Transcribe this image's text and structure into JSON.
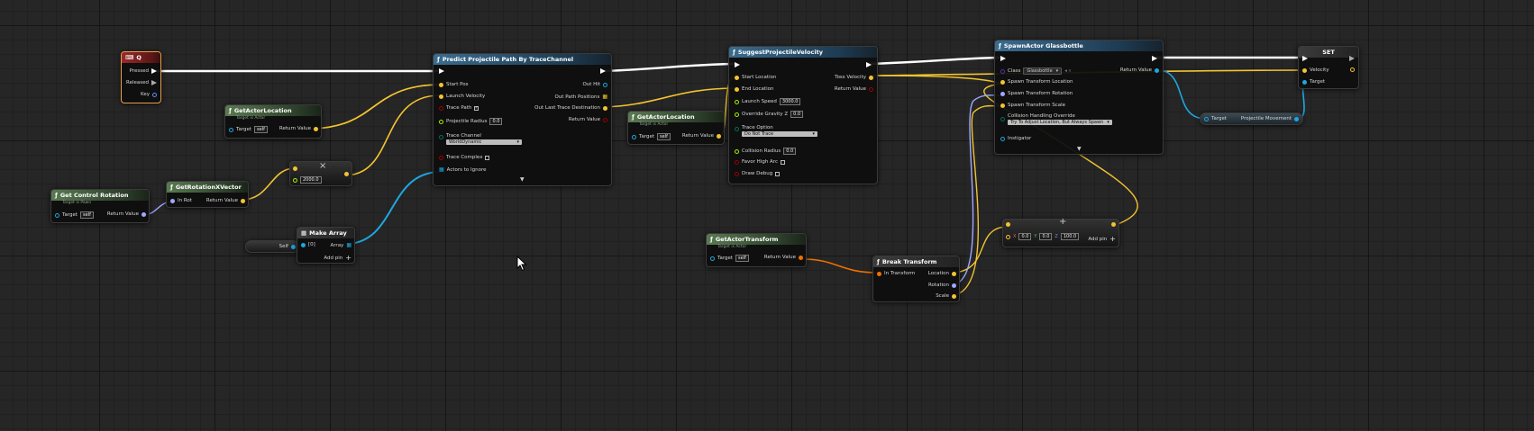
{
  "colors": {
    "exec": "#ffffff",
    "object": "#1ea7e1",
    "vector": "#f3c430",
    "rotator": "#a0a8ff",
    "transform": "#f07000",
    "bool": "#9a0000",
    "float": "#9ef000",
    "byte": "#006d5a",
    "struct": "#5b8cff"
  },
  "nodes": {
    "key_q": {
      "title": "Q",
      "pins": {
        "pressed": "Pressed",
        "released": "Released",
        "key": "Key"
      }
    },
    "get_actor_location_1": {
      "title": "GetActorLocation",
      "subtitle": "Target is Actor",
      "target_label": "Target",
      "target_value": "self",
      "return_label": "Return Value"
    },
    "get_control_rotation": {
      "title": "Get Control Rotation",
      "subtitle": "Target is Pawn",
      "target_label": "Target",
      "target_value": "self",
      "return_label": "Return Value"
    },
    "get_rotation_x_vector": {
      "title": "GetRotationXVector",
      "in_label": "In Rot",
      "return_label": "Return Value"
    },
    "multiply": {
      "symbol": "×",
      "value": "2000.0"
    },
    "self_ref": {
      "label": "Self"
    },
    "make_array": {
      "title": "Make Array",
      "in_label": "[0]",
      "out_label": "Array",
      "add_pin": "Add pin"
    },
    "predict_path": {
      "title": "Predict Projectile Path By TraceChannel",
      "start_pos": "Start Pos",
      "launch_velocity": "Launch Velocity",
      "trace_path": "Trace Path",
      "projectile_radius": "Projectile Radius",
      "projectile_radius_value": "0.0",
      "trace_channel": "Trace Channel",
      "trace_channel_value": "WorldDynamic",
      "trace_complex": "Trace Complex",
      "actors_to_ignore": "Actors to Ignore",
      "out_hit": "Out Hit",
      "out_path_positions": "Out Path Positions",
      "out_last_trace_destination": "Out Last Trace Destination",
      "return_value": "Return Value"
    },
    "get_actor_location_2": {
      "title": "GetActorLocation",
      "subtitle": "Target is Actor",
      "target_label": "Target",
      "target_value": "self",
      "return_label": "Return Value"
    },
    "suggest_velocity": {
      "title": "SuggestProjectileVelocity",
      "start_location": "Start Location",
      "end_location": "End Location",
      "launch_speed": "Launch Speed",
      "launch_speed_value": "3000.0",
      "override_gravity": "Override Gravity Z",
      "override_gravity_value": "0.0",
      "trace_option": "Trace Option",
      "trace_option_value": "Do Not Trace",
      "collision_radius": "Collision Radius",
      "collision_radius_value": "0.0",
      "favor_high_arc": "Favor High Arc",
      "draw_debug": "Draw Debug",
      "toss_velocity": "Toss Velocity",
      "return_value": "Return Value"
    },
    "spawn_actor": {
      "title": "SpawnActor Glassbottle",
      "class_label": "Class",
      "class_value": "Glassbottle",
      "spawn_loc": "Spawn Transform Location",
      "spawn_rot": "Spawn Transform Rotation",
      "spawn_scale": "Spawn Transform Scale",
      "collision_override": "Collision Handling Override",
      "collision_override_value": "Try To Adjust Location, But Always Spawn",
      "instigator": "Instigator",
      "return_value": "Return Value"
    },
    "set_node": {
      "title": "SET",
      "velocity": "Velocity",
      "target": "Target"
    },
    "projectile_movement": {
      "target": "Target",
      "label": "Projectile Movement"
    },
    "get_actor_transform": {
      "title": "GetActorTransform",
      "subtitle": "Target is Actor",
      "target_label": "Target",
      "target_value": "self",
      "return_label": "Return Value"
    },
    "break_transform": {
      "title": "Break Transform",
      "in_label": "In Transform",
      "location": "Location",
      "rotation": "Rotation",
      "scale": "Scale"
    },
    "make_vector_add": {
      "x": "0.0",
      "y": "0.0",
      "z": "100.0",
      "add_pin": "Add pin"
    }
  }
}
